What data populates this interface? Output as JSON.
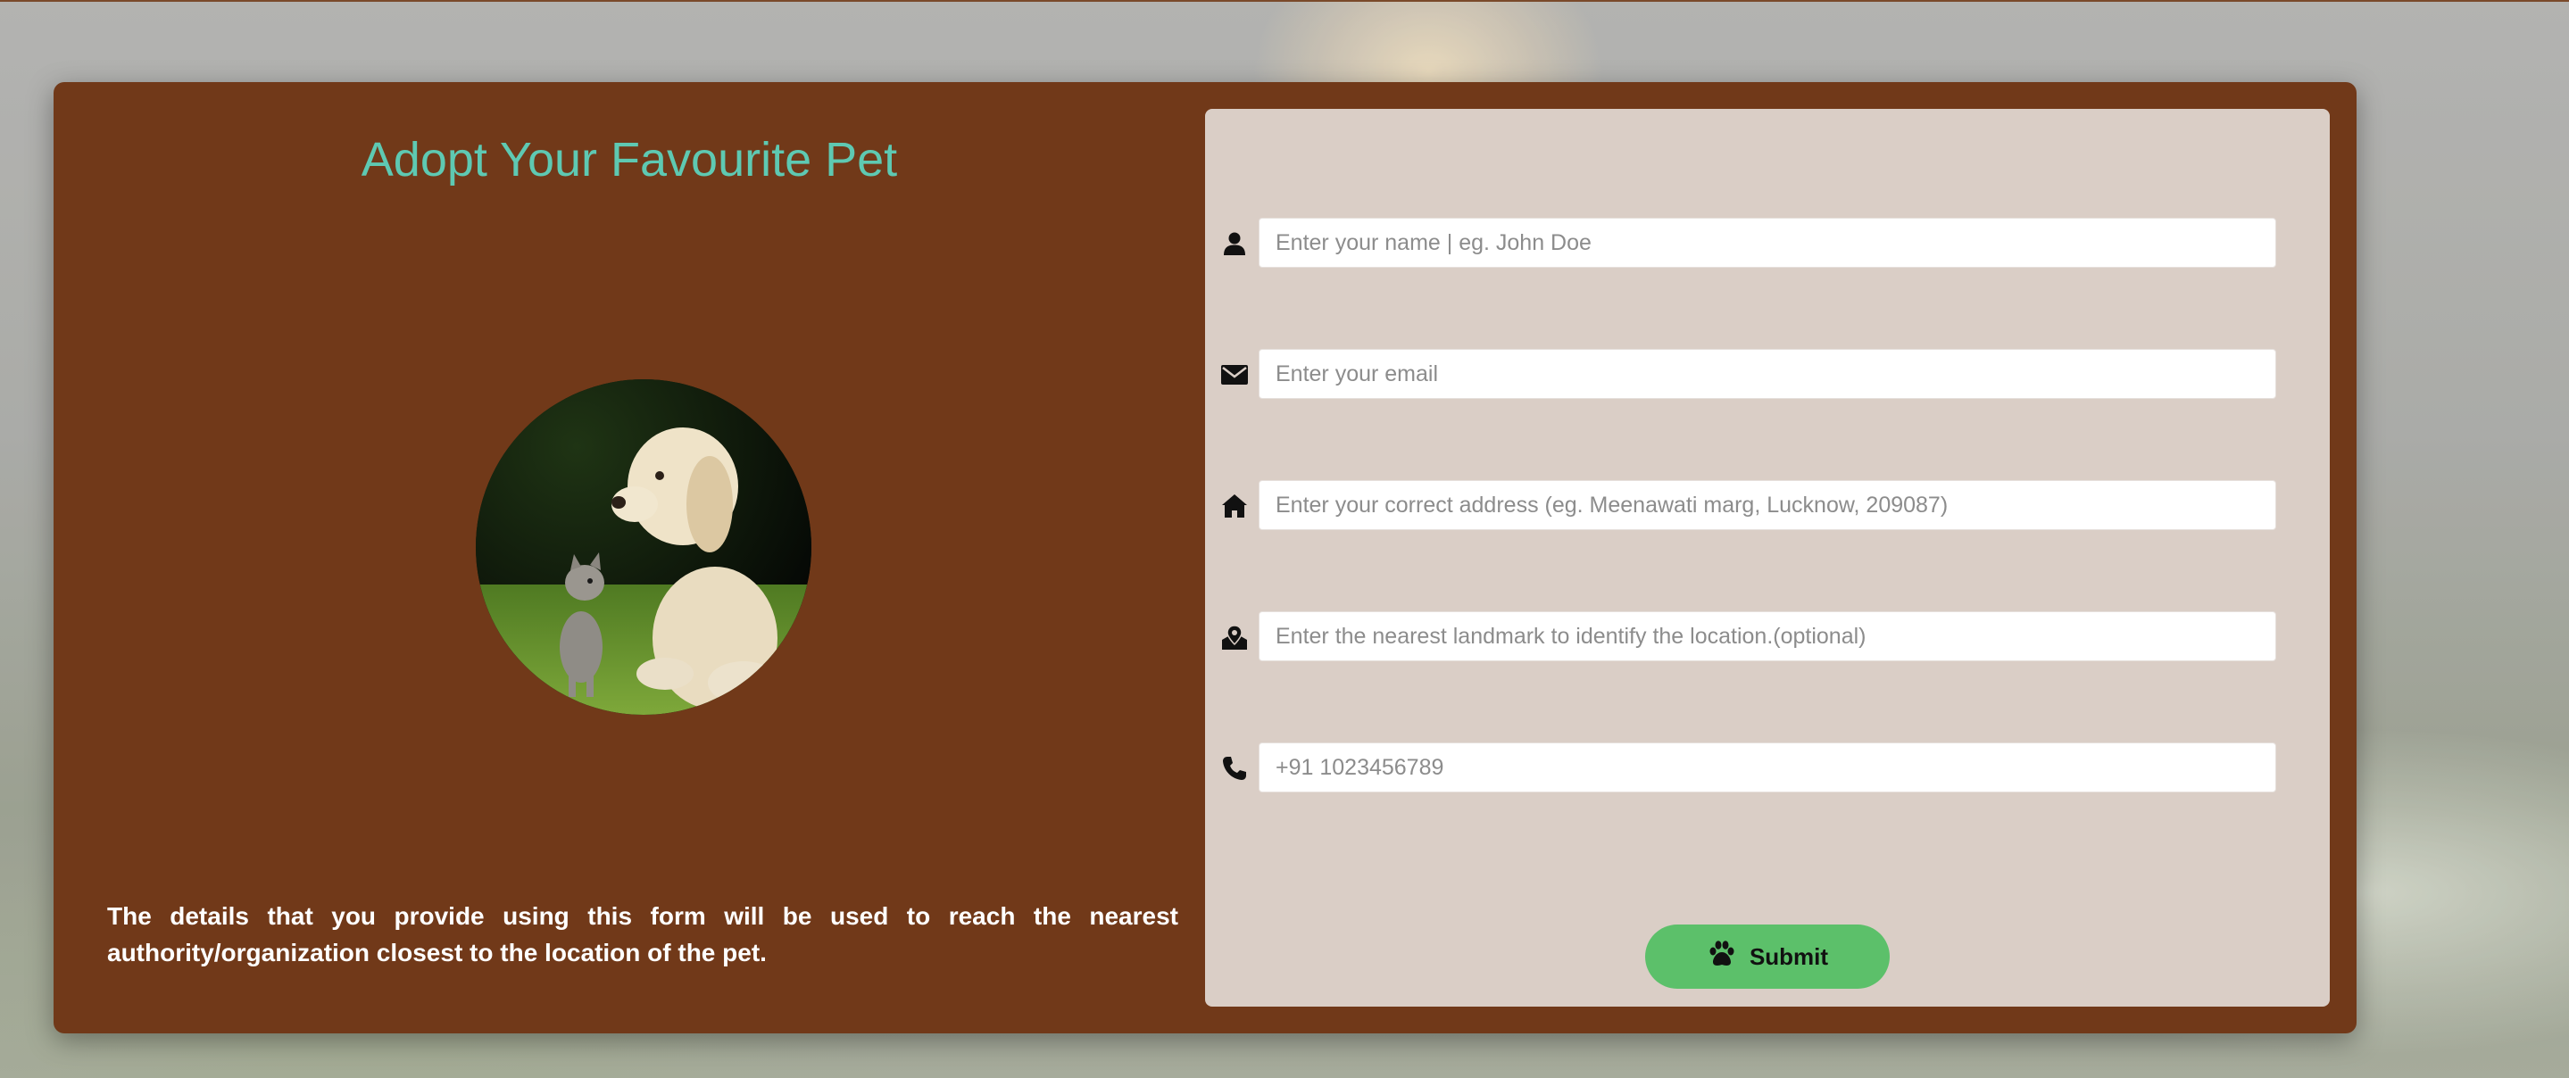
{
  "page": {
    "title": "Adopt Your Favourite Pet",
    "photo_alt": "puppy and kitten",
    "info_text": "The details that you provide using this form will be used to reach the nearest authority/organization closest to the location of the pet."
  },
  "form": {
    "fields": [
      {
        "icon": "person-icon",
        "placeholder": "Enter your name | eg. John Doe",
        "value": ""
      },
      {
        "icon": "envelope-icon",
        "placeholder": "Enter your email",
        "value": ""
      },
      {
        "icon": "home-icon",
        "placeholder": "Enter your correct address (eg. Meenawati marg, Lucknow, 209087)",
        "value": ""
      },
      {
        "icon": "map-pin-icon",
        "placeholder": "Enter the nearest landmark to identify the location.(optional)",
        "value": ""
      },
      {
        "icon": "phone-icon",
        "placeholder": "+91 1023456789",
        "value": ""
      }
    ],
    "submit_label": "Submit",
    "submit_icon": "paw-icon"
  },
  "colors": {
    "card": "#713919",
    "title": "#5ec9b2",
    "panel": "#dacec6",
    "button": "#5cc06a"
  }
}
